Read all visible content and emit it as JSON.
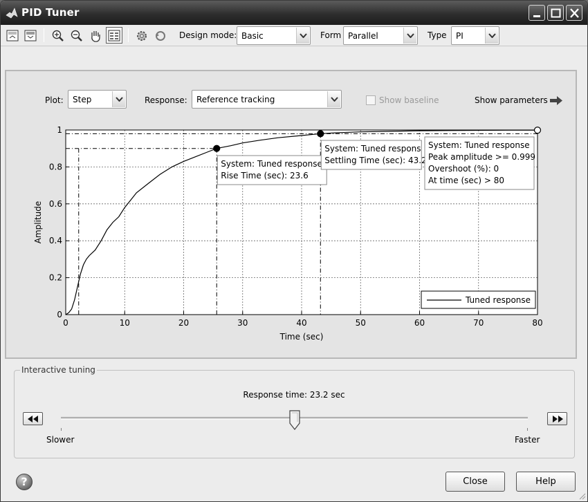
{
  "window": {
    "title": "PID Tuner"
  },
  "toolbar": {
    "design_mode_label": "Design mode:",
    "design_mode_value": "Basic",
    "form_label": "Form",
    "form_value": "Parallel",
    "type_label": "Type",
    "type_value": "PI"
  },
  "plot_controls": {
    "plot_label": "Plot:",
    "plot_value": "Step",
    "response_label": "Response:",
    "response_value": "Reference tracking",
    "show_baseline_label": "Show baseline",
    "show_baseline_checked": false,
    "show_parameters_label": "Show parameters"
  },
  "chart_data": {
    "type": "line",
    "xlabel": "Time (sec)",
    "ylabel": "Amplitude",
    "xlim": [
      0,
      80
    ],
    "ylim": [
      0,
      1
    ],
    "x_ticks": [
      0,
      10,
      20,
      30,
      40,
      50,
      60,
      70,
      80
    ],
    "y_ticks": [
      0,
      0.2,
      0.4,
      0.6,
      0.8,
      1
    ],
    "grid": true,
    "legend_position": "bottom-right",
    "series": [
      {
        "name": "Tuned response",
        "x": [
          0,
          0.5,
          1,
          1.5,
          2,
          2.5,
          3,
          3.5,
          4,
          5,
          6,
          7,
          8,
          9,
          10,
          11,
          12,
          14,
          16,
          18,
          20,
          22,
          24,
          25.6,
          28,
          30,
          33,
          36,
          40,
          43.2,
          46,
          50,
          55,
          60,
          65,
          70,
          75,
          80
        ],
        "y": [
          0,
          0.01,
          0.03,
          0.08,
          0.15,
          0.22,
          0.27,
          0.3,
          0.32,
          0.35,
          0.4,
          0.46,
          0.5,
          0.53,
          0.58,
          0.62,
          0.66,
          0.71,
          0.76,
          0.8,
          0.83,
          0.855,
          0.88,
          0.9,
          0.915,
          0.93,
          0.945,
          0.958,
          0.97,
          0.98,
          0.985,
          0.99,
          0.993,
          0.996,
          0.997,
          0.998,
          0.999,
          0.999
        ]
      }
    ],
    "markers": [
      {
        "x": 25.6,
        "y": 0.9,
        "style": "filled"
      },
      {
        "x": 43.2,
        "y": 0.98,
        "style": "filled"
      },
      {
        "x": 80,
        "y": 0.999,
        "style": "open"
      }
    ],
    "annotations": [
      {
        "lines": [
          "System: Tuned response",
          "Rise Time (sec): 23.6"
        ]
      },
      {
        "lines": [
          "System: Tuned respons",
          "Settling Time (sec): 43.2"
        ]
      },
      {
        "lines": [
          "System: Tuned response",
          "Peak amplitude >= 0.999",
          "Overshoot (%): 0",
          "At time (sec) > 80"
        ]
      }
    ]
  },
  "tuning": {
    "title": "Interactive tuning",
    "response_time_text": "Response time: 23.2 sec",
    "slider_position": 0.5,
    "slower_label": "Slower",
    "faster_label": "Faster"
  },
  "buttons": {
    "close": "Close",
    "help": "Help"
  },
  "colors": {
    "titlebar": "#2e2e2e",
    "panel": "#e4e4e4",
    "plot_background": "#ffffff",
    "curve": "#000000"
  }
}
